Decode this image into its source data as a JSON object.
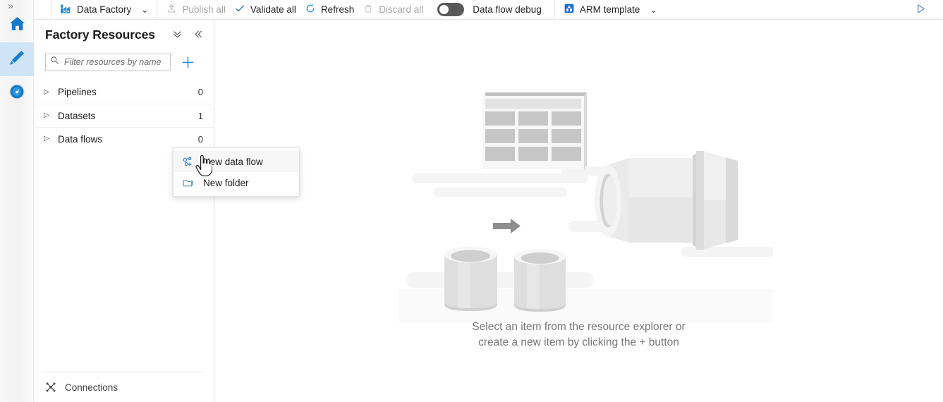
{
  "rail": {
    "expand_glyph": "»",
    "items": [
      {
        "name": "home",
        "title": "Home"
      },
      {
        "name": "author",
        "title": "Author"
      },
      {
        "name": "monitor",
        "title": "Monitor"
      }
    ]
  },
  "toolbar": {
    "product_label": "Data Factory",
    "product_chevron": "⌄",
    "publish_all_label": "Publish all",
    "validate_all_label": "Validate all",
    "refresh_label": "Refresh",
    "discard_all_label": "Discard all",
    "data_flow_debug_label": "Data flow debug",
    "data_flow_debug_state": "off",
    "arm_template_label": "ARM template",
    "arm_chevron": "⌄",
    "run_glyph": "▷",
    "accent_color": "#0078d4"
  },
  "panel": {
    "title": "Factory Resources",
    "collapse_all_glyph": "⌄⌄",
    "collapse_panel_glyph": "«",
    "filter": {
      "placeholder": "Filter resources by name",
      "value": ""
    },
    "add_glyph": "+",
    "tree": [
      {
        "label": "Pipelines",
        "count": "0",
        "caret": "▷"
      },
      {
        "label": "Datasets",
        "count": "1",
        "caret": "▷"
      },
      {
        "label": "Data flows",
        "count": "0",
        "caret": "▷"
      }
    ],
    "footer": {
      "label": "Connections"
    }
  },
  "context_menu": {
    "items": [
      {
        "label": "New data flow",
        "icon": "data-flow-icon",
        "hovered": true
      },
      {
        "label": "New folder",
        "icon": "folder-icon",
        "hovered": false
      }
    ]
  },
  "canvas": {
    "empty_state_line1": "Select an item from the resource explorer or",
    "empty_state_line2": "create a new item by clicking the + button"
  },
  "colors": {
    "accent": "#0078d4",
    "panel_bg": "#ffffff",
    "rail_bg": "#f3f3f3",
    "selected_rail": "#cfe4f7",
    "illustration_grey": "#dcdcdc",
    "text_muted": "#767676"
  }
}
